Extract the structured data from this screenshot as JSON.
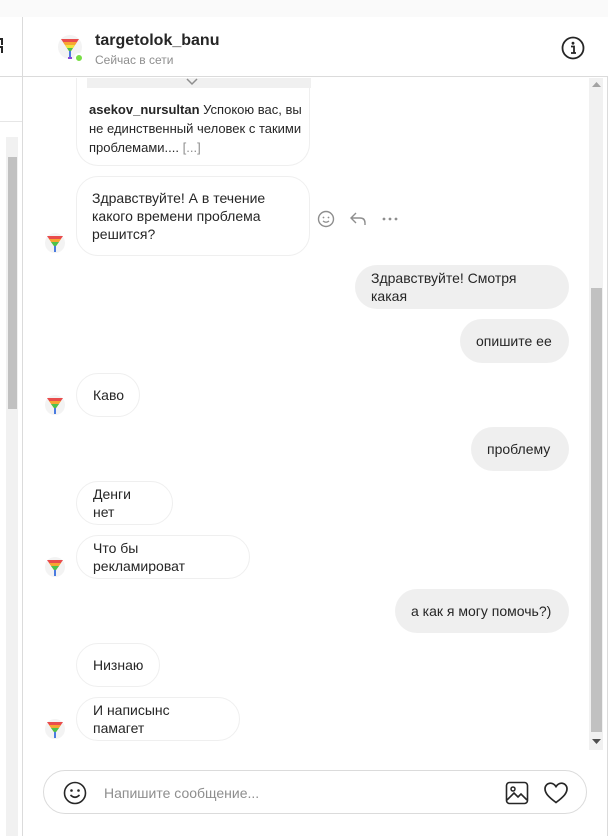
{
  "header": {
    "username": "targetolok_banu",
    "status": "Сейчас в сети",
    "info_icon": "info-icon",
    "avatar_icon": "rainbow-funnel-avatar"
  },
  "shared_post": {
    "username": "asekov_nursultan",
    "text": "Успокою вас, вы не единственный человек с такими проблемами....",
    "more": "[...]"
  },
  "messages": [
    {
      "side": "in",
      "text": "Здравствуйте! А в течение какого времени проблема решится?"
    },
    {
      "side": "out",
      "text": "Здравствуйте! Смотря какая"
    },
    {
      "side": "out",
      "text": "опишите ее"
    },
    {
      "side": "in",
      "text": "Каво"
    },
    {
      "side": "out",
      "text": "проблему"
    },
    {
      "side": "in",
      "text": "Денги нет"
    },
    {
      "side": "in",
      "text": "Что бы рекламироват"
    },
    {
      "side": "out",
      "text": "а как я могу помочь?)"
    },
    {
      "side": "in",
      "text": "Низнаю"
    },
    {
      "side": "in",
      "text": "И написынс памагет"
    }
  ],
  "message_actions": [
    "smile-icon",
    "reply-icon",
    "more-icon"
  ],
  "composer": {
    "placeholder": "Напишите сообщение...",
    "emoji_icon": "emoji-icon",
    "photo_icon": "photo-icon",
    "heart_icon": "heart-icon"
  },
  "colors": {
    "online": "#78de45",
    "outgoing_bubble": "#efefef",
    "border": "#dbdbdb",
    "muted_text": "#8e8e8e"
  }
}
